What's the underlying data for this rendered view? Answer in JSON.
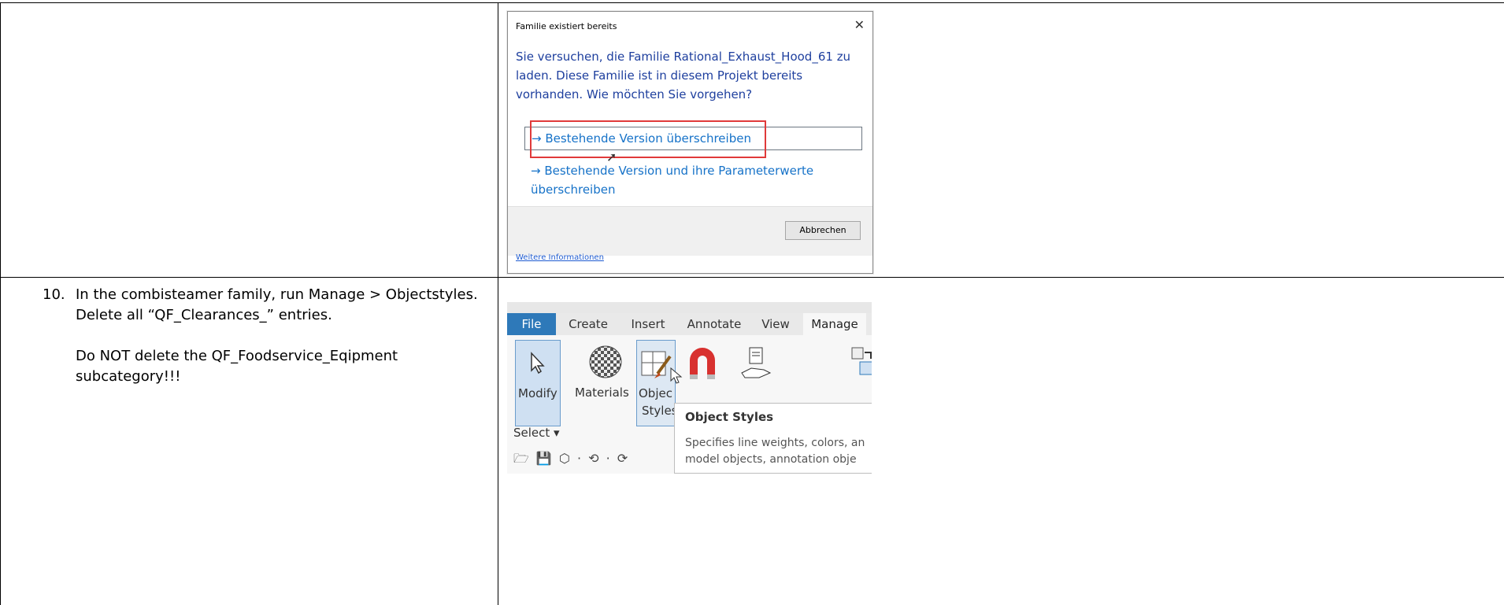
{
  "dialog": {
    "title": "Familie existiert bereits",
    "close": "✕",
    "message": "Sie versuchen, die Familie Rational_Exhaust_Hood_61 zu laden. Diese Familie ist in diesem Projekt bereits vorhanden. Wie möchten Sie vorgehen?",
    "option1": "→ Bestehende Version überschreiben",
    "option2": "→ Bestehende Version und ihre Parameterwerte überschreiben",
    "cancel": "Abbrechen",
    "link": "Weitere Informationen",
    "highlight_color": "#e03a3a"
  },
  "step": {
    "number": "10.",
    "text1": "In the combisteamer family, run Manage > Objectstyles. Delete all “QF_Clearances_” entries.",
    "text2": "Do NOT delete the QF_Foodservice_Eqipment subcategory!!!"
  },
  "ribbon": {
    "tabs": [
      "File",
      "Create",
      "Insert",
      "Annotate",
      "View",
      "Manage"
    ],
    "modify": "Modify",
    "materials": "Materials",
    "object_styles_1": "Objec",
    "object_styles_2": "Styles",
    "select": "Select ▾",
    "tooltip_title": "Object Styles",
    "tooltip_line1": "Specifies line weights, colors, an",
    "tooltip_line2": "model objects, annotation obje",
    "accent_color": "#2e79b9"
  }
}
